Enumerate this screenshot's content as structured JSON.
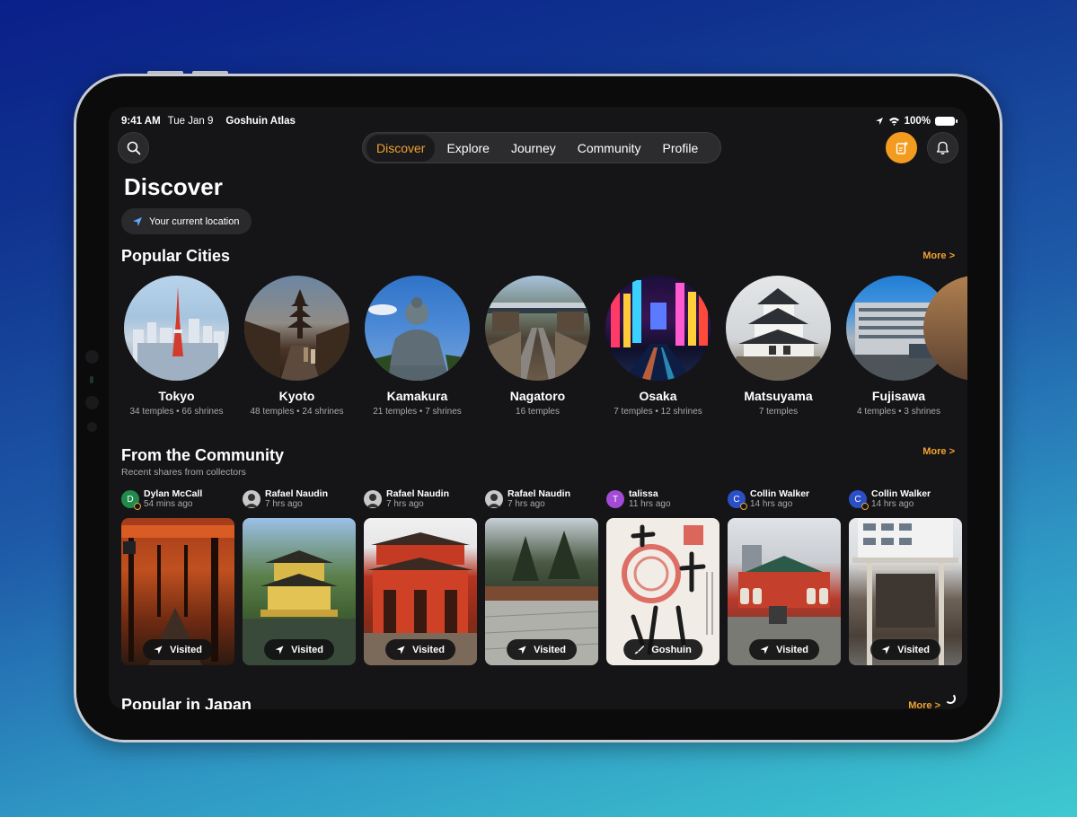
{
  "status": {
    "time": "9:41 AM",
    "date": "Tue Jan 9",
    "app": "Goshuin Atlas",
    "battery": "100%"
  },
  "nav": {
    "tabs": [
      {
        "label": "Discover",
        "active": true
      },
      {
        "label": "Explore",
        "active": false
      },
      {
        "label": "Journey",
        "active": false
      },
      {
        "label": "Community",
        "active": false
      },
      {
        "label": "Profile",
        "active": false
      }
    ]
  },
  "page": {
    "title": "Discover",
    "location_label": "Your current location"
  },
  "popular_cities": {
    "title": "Popular Cities",
    "more": "More >",
    "items": [
      {
        "name": "Tokyo",
        "stats": "34 temples • 66 shrines"
      },
      {
        "name": "Kyoto",
        "stats": "48 temples • 24 shrines"
      },
      {
        "name": "Kamakura",
        "stats": "21 temples • 7 shrines"
      },
      {
        "name": "Nagatoro",
        "stats": "16 temples"
      },
      {
        "name": "Osaka",
        "stats": "7 temples • 12 shrines"
      },
      {
        "name": "Matsuyama",
        "stats": "7 temples"
      },
      {
        "name": "Fujisawa",
        "stats": "4 temples • 3 shrines"
      }
    ]
  },
  "community": {
    "title": "From the Community",
    "subtitle": "Recent shares from collectors",
    "more": "More >",
    "posts": [
      {
        "user": "Dylan McCall",
        "time": "54 mins ago",
        "badge": "Visited",
        "initial": "D"
      },
      {
        "user": "Rafael Naudin",
        "time": "7 hrs ago",
        "badge": "Visited"
      },
      {
        "user": "Rafael Naudin",
        "time": "7 hrs ago",
        "badge": "Visited"
      },
      {
        "user": "Rafael Naudin",
        "time": "7 hrs ago",
        "badge": "Visited"
      },
      {
        "user": "talissa",
        "time": "11 hrs ago",
        "badge": "Goshuin",
        "initial": "T"
      },
      {
        "user": "Collin Walker",
        "time": "14 hrs ago",
        "badge": "Visited",
        "initial": "C"
      },
      {
        "user": "Collin Walker",
        "time": "14 hrs ago",
        "badge": "Visited",
        "initial": "C"
      }
    ]
  },
  "popular_japan": {
    "title": "Popular in Japan",
    "more": "More >"
  },
  "colors": {
    "accent": "#f2a12e",
    "background": "#151517",
    "add_button": "#f29b1f"
  }
}
